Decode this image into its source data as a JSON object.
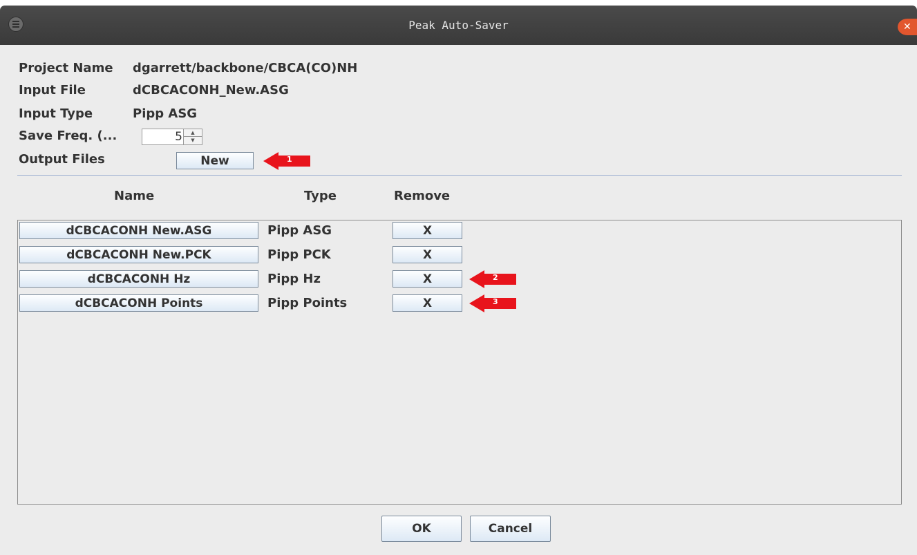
{
  "window": {
    "title": "Peak Auto-Saver"
  },
  "fields": {
    "project_name_label": "Project Name",
    "project_name_value": "dgarrett/backbone/CBCA(CO)NH",
    "input_file_label": "Input File",
    "input_file_value": "dCBCACONH_New.ASG",
    "input_type_label": "Input Type",
    "input_type_value": "Pipp ASG",
    "save_freq_label": "Save Freq. (...",
    "save_freq_value": "5",
    "output_files_label": "Output Files",
    "new_button_label": "New"
  },
  "columns": {
    "name": "Name",
    "type": "Type",
    "remove": "Remove"
  },
  "rows": [
    {
      "name": "dCBCACONH New.ASG",
      "type": "Pipp ASG",
      "remove": "X"
    },
    {
      "name": "dCBCACONH New.PCK",
      "type": "Pipp PCK",
      "remove": "X"
    },
    {
      "name": "dCBCACONH Hz",
      "type": "Pipp Hz",
      "remove": "X"
    },
    {
      "name": "dCBCACONH Points",
      "type": "Pipp Points",
      "remove": "X"
    }
  ],
  "annotations": [
    "1",
    "2",
    "3"
  ],
  "footer": {
    "ok_label": "OK",
    "cancel_label": "Cancel"
  },
  "colors": {
    "annotation_arrow": "#e8141c",
    "title_bar": "#3f3f3f",
    "close_button": "#e2562e",
    "separator": "#9aaed0"
  }
}
